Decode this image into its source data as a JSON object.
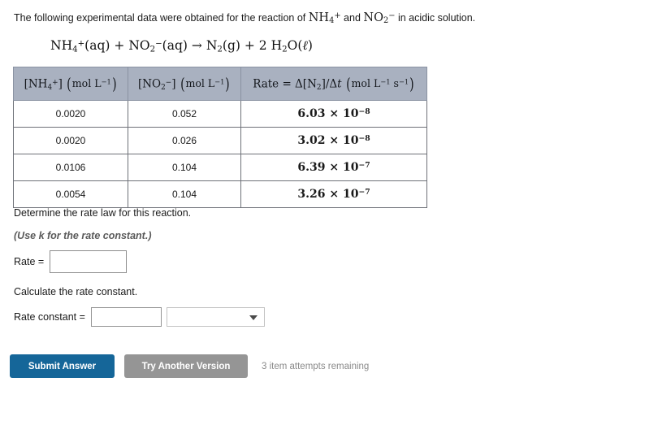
{
  "problem": {
    "intro_prefix": "The following experimental data were obtained for the reaction of ",
    "intro_species_1": "NH4+",
    "intro_joiner": " and ",
    "intro_species_2": "NO2-",
    "intro_suffix": " in acidic solution.",
    "equation": "NH4+(aq) + NO2-(aq) → N2(g) + 2 H2O(ℓ)",
    "equation_parts": {
      "reactant1": "NH",
      "reactant1_sub": "4",
      "reactant1_sup": "+",
      "state1": "(aq)",
      "plus": "+",
      "reactant2": "NO",
      "reactant2_sub": "2",
      "reactant2_sup": "−",
      "state2": "(aq)",
      "arrow": "→",
      "product1": "N",
      "product1_sub": "2",
      "state3": "(g)",
      "plus2": "+",
      "coefficient": "2",
      "product2_a": "H",
      "product2_sub": "2",
      "product2_b": "O",
      "state4_open": "(",
      "state4_ell": "ℓ",
      "state4_close": ")"
    }
  },
  "chart_data": {
    "type": "table",
    "title": "Experimental kinetics data",
    "columns": [
      {
        "formula": "[NH4+]",
        "species": "NH",
        "species_sub": "4",
        "species_sup": "+",
        "units": "mol L-1",
        "units_base": "mol L",
        "units_exp": "−1"
      },
      {
        "formula": "[NO2-]",
        "species": "NO",
        "species_sub": "2",
        "species_sup": "−",
        "units": "mol L-1",
        "units_base": "mol L",
        "units_exp": "−1"
      },
      {
        "formula": "Rate = Δ[N2]/Δt",
        "rate_prefix": "Rate = Δ[N",
        "rate_sub": "2",
        "rate_mid": "]/Δ",
        "rate_var": "t",
        "units": "mol L-1 s-1",
        "units_base_1": "mol L",
        "units_exp_1": "−1",
        "units_base_2": "s",
        "units_exp_2": "−1"
      }
    ],
    "rows": [
      {
        "nh4": "0.0020",
        "no2": "0.052",
        "rate_mantissa": "6.03",
        "rate_times": "×",
        "rate_base": "10",
        "rate_exp": "−8",
        "rate": "6.03 × 10^-8"
      },
      {
        "nh4": "0.0020",
        "no2": "0.026",
        "rate_mantissa": "3.02",
        "rate_times": "×",
        "rate_base": "10",
        "rate_exp": "−8",
        "rate": "3.02 × 10^-8"
      },
      {
        "nh4": "0.0106",
        "no2": "0.104",
        "rate_mantissa": "6.39",
        "rate_times": "×",
        "rate_base": "10",
        "rate_exp": "−7",
        "rate": "6.39 × 10^-7"
      },
      {
        "nh4": "0.0054",
        "no2": "0.104",
        "rate_mantissa": "3.26",
        "rate_times": "×",
        "rate_base": "10",
        "rate_exp": "−7",
        "rate": "3.26 × 10^-7"
      }
    ]
  },
  "questions": {
    "q1_text": "Determine the rate law for this reaction.",
    "q1_note": "(Use k for the rate constant.)",
    "rate_label": "Rate =",
    "rate_value": "",
    "rate_placeholder": "",
    "q2_text": "Calculate the rate constant.",
    "constant_label": "Rate constant =",
    "constant_value": "",
    "constant_placeholder": "",
    "units_selected": "",
    "units_icon": "chevron-down-icon"
  },
  "actions": {
    "submit_label": "Submit Answer",
    "another_label": "Try Another Version",
    "attempts_text": "3 item attempts remaining",
    "submit_color": "#156699",
    "another_color": "#959595",
    "attempts_color": "#8a8a8a"
  }
}
